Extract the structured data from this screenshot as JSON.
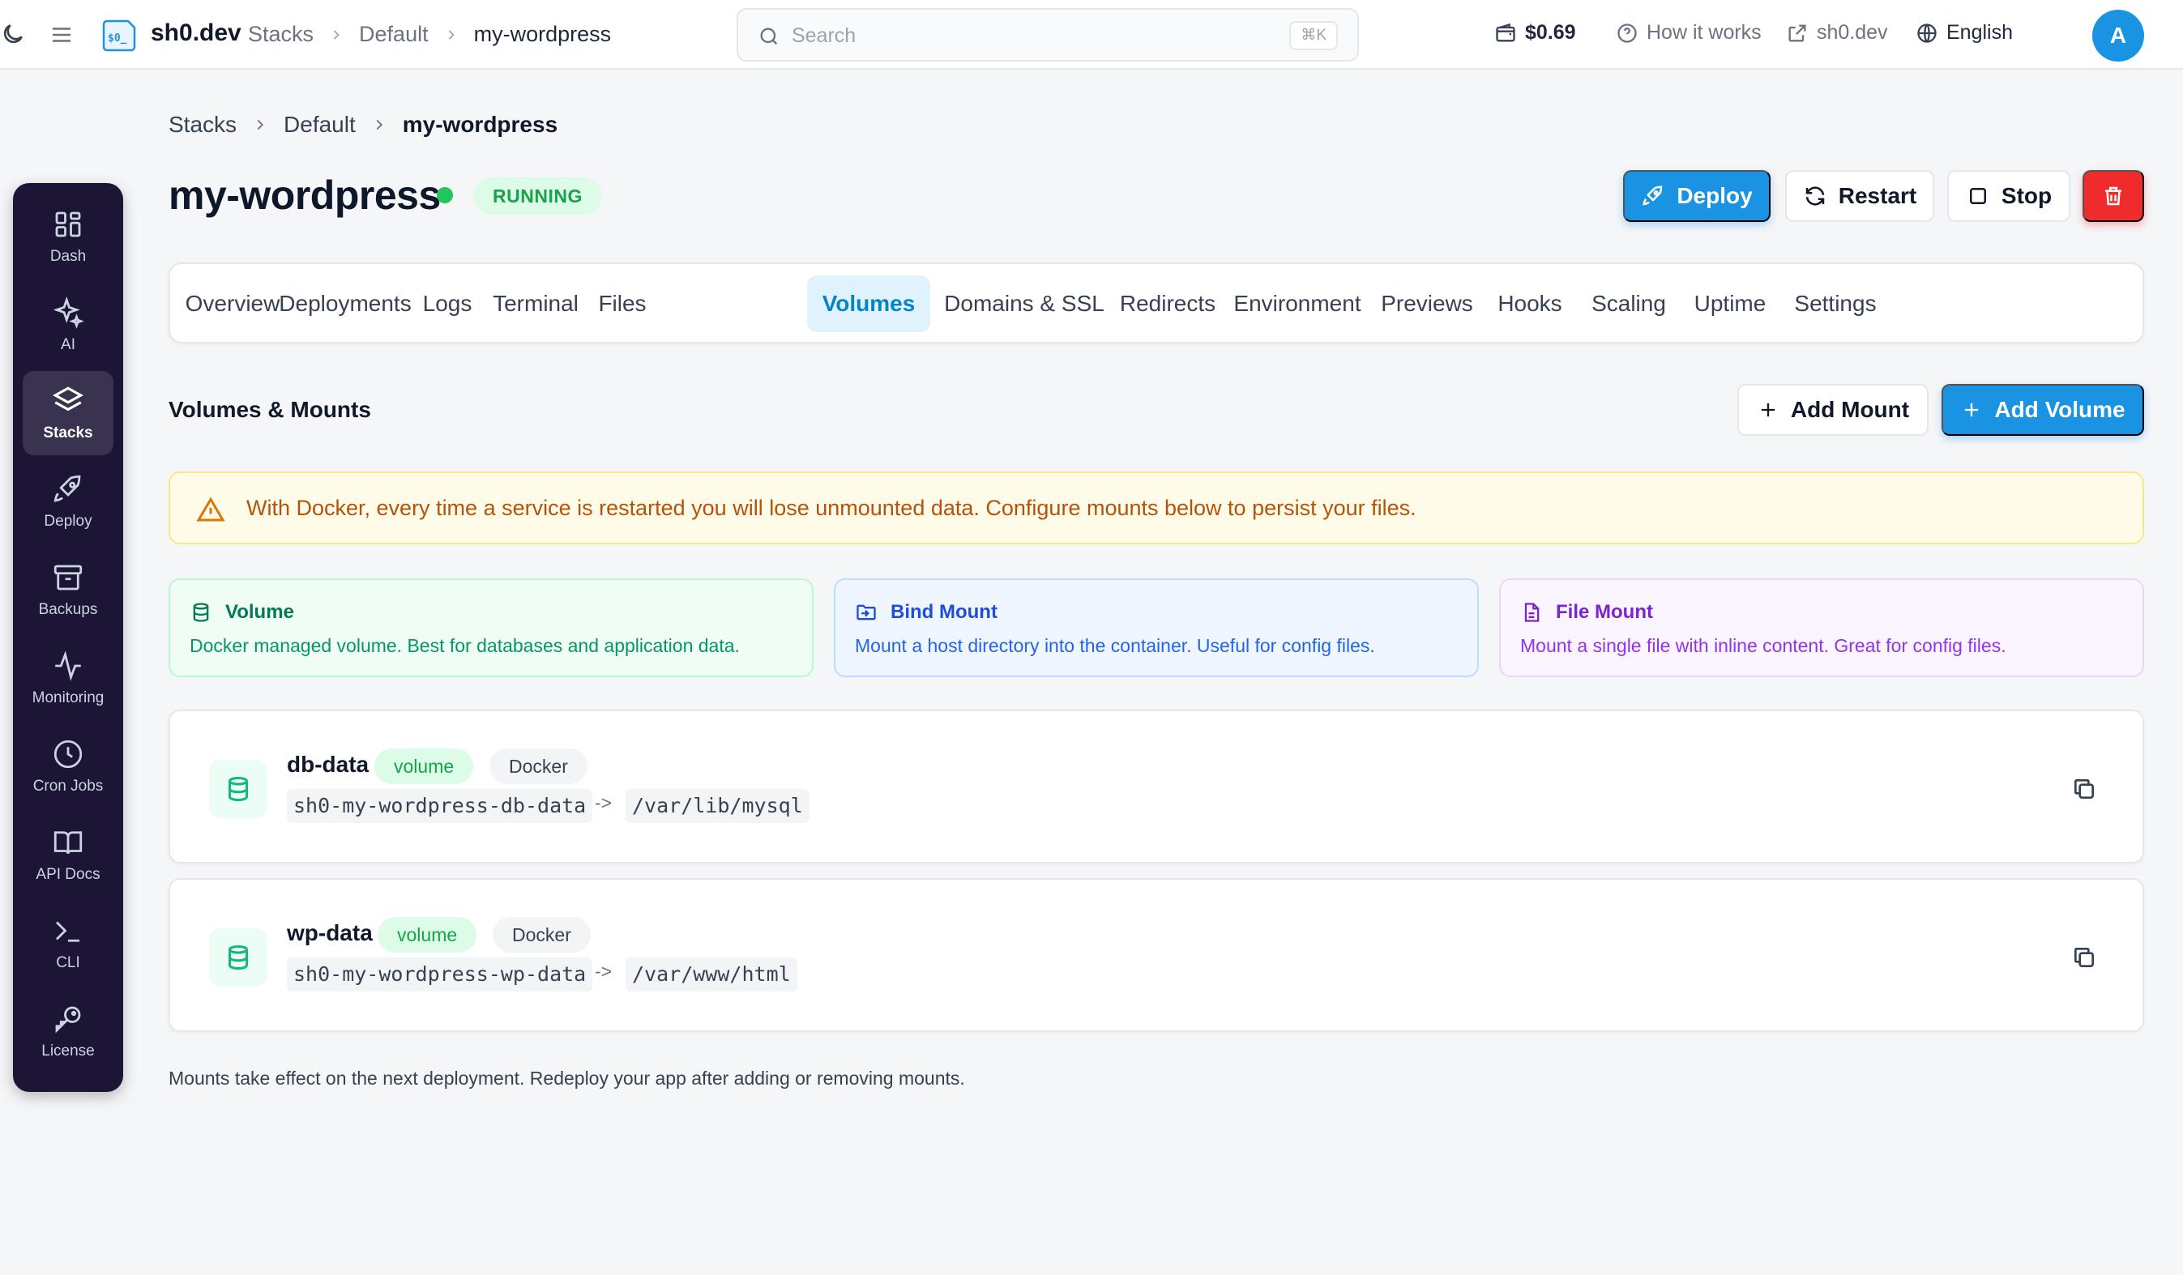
{
  "topbar": {
    "brand": "sh0.dev",
    "logo_text": "$0_",
    "breadcrumbs": [
      "Stacks",
      "Default",
      "my-wordpress"
    ],
    "search": {
      "placeholder": "Search",
      "shortcut": "⌘K"
    },
    "balance": "$0.69",
    "how_it_works": "How it works",
    "site_link": "sh0.dev",
    "language": "English",
    "avatar_initial": "A"
  },
  "sidebar": {
    "items": [
      {
        "label": "Dash",
        "icon": "grid-icon"
      },
      {
        "label": "AI",
        "icon": "sparkles-icon"
      },
      {
        "label": "Stacks",
        "icon": "layers-icon",
        "active": true
      },
      {
        "label": "Deploy",
        "icon": "rocket-icon"
      },
      {
        "label": "Backups",
        "icon": "archive-icon"
      },
      {
        "label": "Monitoring",
        "icon": "activity-icon"
      },
      {
        "label": "Cron Jobs",
        "icon": "clock-icon"
      },
      {
        "label": "API Docs",
        "icon": "book-icon"
      },
      {
        "label": "CLI",
        "icon": "terminal-icon"
      },
      {
        "label": "License",
        "icon": "key-icon"
      }
    ]
  },
  "page": {
    "breadcrumbs": [
      "Stacks",
      "Default",
      "my-wordpress"
    ],
    "title": "my-wordpress",
    "status": "RUNNING",
    "actions": {
      "deploy": "Deploy",
      "restart": "Restart",
      "stop": "Stop"
    }
  },
  "tabs": [
    {
      "label": "Overview"
    },
    {
      "label": "Deployments"
    },
    {
      "label": "Logs"
    },
    {
      "label": "Terminal"
    },
    {
      "label": "Files"
    },
    {
      "label": "Volumes",
      "active": true
    },
    {
      "label": "Domains & SSL"
    },
    {
      "label": "Redirects"
    },
    {
      "label": "Environment"
    },
    {
      "label": "Previews"
    },
    {
      "label": "Hooks"
    },
    {
      "label": "Scaling"
    },
    {
      "label": "Uptime"
    },
    {
      "label": "Settings"
    }
  ],
  "volumes": {
    "title": "Volumes & Mounts",
    "add_mount": "Add Mount",
    "add_volume": "Add Volume",
    "warning": "With Docker, every time a service is restarted you will lose unmounted data. Configure mounts below to persist your files.",
    "types": [
      {
        "title": "Volume",
        "desc": "Docker managed volume. Best for databases and application data."
      },
      {
        "title": "Bind Mount",
        "desc": "Mount a host directory into the container. Useful for config files."
      },
      {
        "title": "File Mount",
        "desc": "Mount a single file with inline content. Great for config files."
      }
    ],
    "mounts": [
      {
        "name": "db-data",
        "kind": "volume",
        "driver": "Docker",
        "source": "sh0-my-wordpress-db-data",
        "arrow": "->",
        "target": "/var/lib/mysql"
      },
      {
        "name": "wp-data",
        "kind": "volume",
        "driver": "Docker",
        "source": "sh0-my-wordpress-wp-data",
        "arrow": "->",
        "target": "/var/www/html"
      }
    ],
    "footnote": "Mounts take effect on the next deployment. Redeploy your app after adding or removing mounts."
  },
  "colors": {
    "accent": "#1b93e3",
    "sidebar_bg": "#1c1535",
    "running": "#22c55e",
    "danger": "#ef2b2b"
  }
}
